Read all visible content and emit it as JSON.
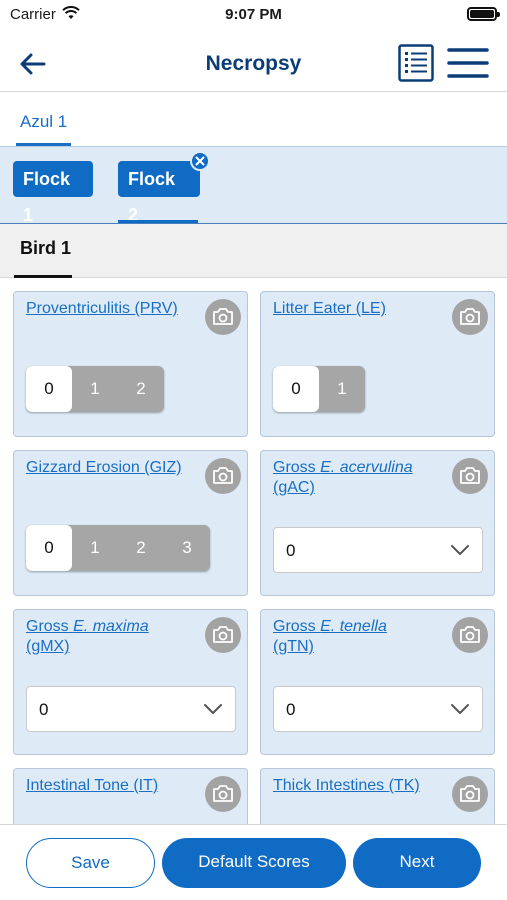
{
  "status_bar": {
    "carrier": "Carrier",
    "time": "9:07 PM"
  },
  "nav": {
    "title": "Necropsy"
  },
  "farm_tab": {
    "label": "Azul 1"
  },
  "flocks": [
    {
      "label": "Flock 1"
    },
    {
      "label": "Flock 2"
    }
  ],
  "bird_tab": {
    "label": "Bird 1"
  },
  "cards": [
    {
      "title": "Proventriculitis (PRV)",
      "type": "segmented",
      "options": [
        "0",
        "1",
        "2"
      ],
      "selected": "0"
    },
    {
      "title": "Litter Eater (LE)",
      "type": "segmented",
      "options": [
        "0",
        "1"
      ],
      "selected": "0"
    },
    {
      "title": "Gizzard Erosion (GIZ)",
      "type": "segmented",
      "options": [
        "0",
        "1",
        "2",
        "3"
      ],
      "selected": "0"
    },
    {
      "title_a": "Gross ",
      "title_em": "E. acervulina",
      "title_b": "(gAC)",
      "type": "dropdown",
      "value": "0"
    },
    {
      "title_a": "Gross ",
      "title_em": "E. maxima",
      "title_b": "(gMX)",
      "type": "dropdown",
      "value": "0"
    },
    {
      "title_a": "Gross ",
      "title_em": "E. tenella",
      "title_b": "(gTN)",
      "type": "dropdown",
      "value": "0"
    },
    {
      "title": "Intestinal Tone (IT)"
    },
    {
      "title": "Thick Intestines (TK)"
    }
  ],
  "actions": {
    "save": "Save",
    "default_scores": "Default Scores",
    "next": "Next"
  },
  "colors": {
    "primary": "#0f6bc4",
    "title": "#0a3d78",
    "card_bg": "#deebf7",
    "segment_off": "#a6a6a6"
  },
  "icons": [
    "wifi-icon",
    "battery-icon",
    "back-arrow-icon",
    "list-icon",
    "hamburger-menu-icon",
    "close-icon",
    "camera-icon",
    "chevron-down-icon"
  ]
}
